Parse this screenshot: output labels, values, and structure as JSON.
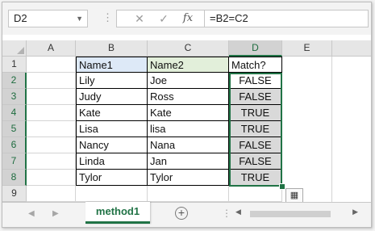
{
  "formula_bar": {
    "name_box": "D2",
    "cancel_icon": "✕",
    "confirm_icon": "✓",
    "fx_label": "fx",
    "formula": "=B2=C2"
  },
  "columns": [
    "A",
    "B",
    "C",
    "D",
    "E"
  ],
  "rows": [
    "1",
    "2",
    "3",
    "4",
    "5",
    "6",
    "7",
    "8",
    "9"
  ],
  "table": {
    "headers": [
      "Name1",
      "Name2",
      "Match?"
    ],
    "data": [
      {
        "name1": "Lily",
        "name2": "Joe",
        "match": "FALSE"
      },
      {
        "name1": "Judy",
        "name2": "Ross",
        "match": "FALSE"
      },
      {
        "name1": "Kate",
        "name2": "Kate",
        "match": "TRUE"
      },
      {
        "name1": "Lisa",
        "name2": "lisa",
        "match": "TRUE"
      },
      {
        "name1": "Nancy",
        "name2": "Nana",
        "match": "FALSE"
      },
      {
        "name1": "Linda",
        "name2": "Jan",
        "match": "FALSE"
      },
      {
        "name1": "Tylor",
        "name2": "Tylor",
        "match": "TRUE"
      }
    ]
  },
  "sheet_tabs": {
    "active": "method1",
    "add_icon": "+"
  },
  "colors": {
    "accent": "#217346",
    "header_blue": "#dde9f7",
    "header_green": "#e2efda",
    "selection_grey": "#d9d9d9"
  }
}
